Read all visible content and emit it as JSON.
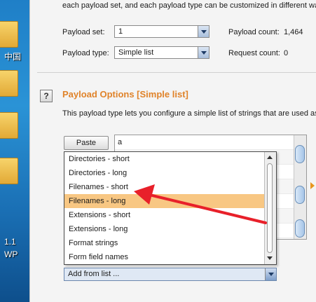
{
  "desktop": {
    "labels": [
      "中国",
      "1.1",
      "WP"
    ]
  },
  "intro_text": "each payload set, and each payload type can be customized in different wa",
  "payload_set": {
    "label": "Payload set:",
    "value": "1"
  },
  "payload_count": {
    "label": "Payload count:",
    "value": "1,464"
  },
  "payload_type": {
    "label": "Payload type:",
    "value": "Simple list"
  },
  "request_count": {
    "label": "Request count:",
    "value": "0"
  },
  "options": {
    "help_glyph": "?",
    "title": "Payload Options [Simple list]",
    "description": "This payload type lets you configure a simple list of strings that are used as"
  },
  "buttons": {
    "paste": "Paste"
  },
  "list_value": "a",
  "dropdown": {
    "items": [
      "Directories - short",
      "Directories - long",
      "Filenames - short",
      "Filenames - long",
      "Extensions - short",
      "Extensions - long",
      "Format strings",
      "Form field names"
    ],
    "selected_index": 3,
    "combo_value": "Add from list ..."
  },
  "colors": {
    "accent": "#e0832a",
    "selected": "#f8c783",
    "arrow": "#e8202a"
  }
}
